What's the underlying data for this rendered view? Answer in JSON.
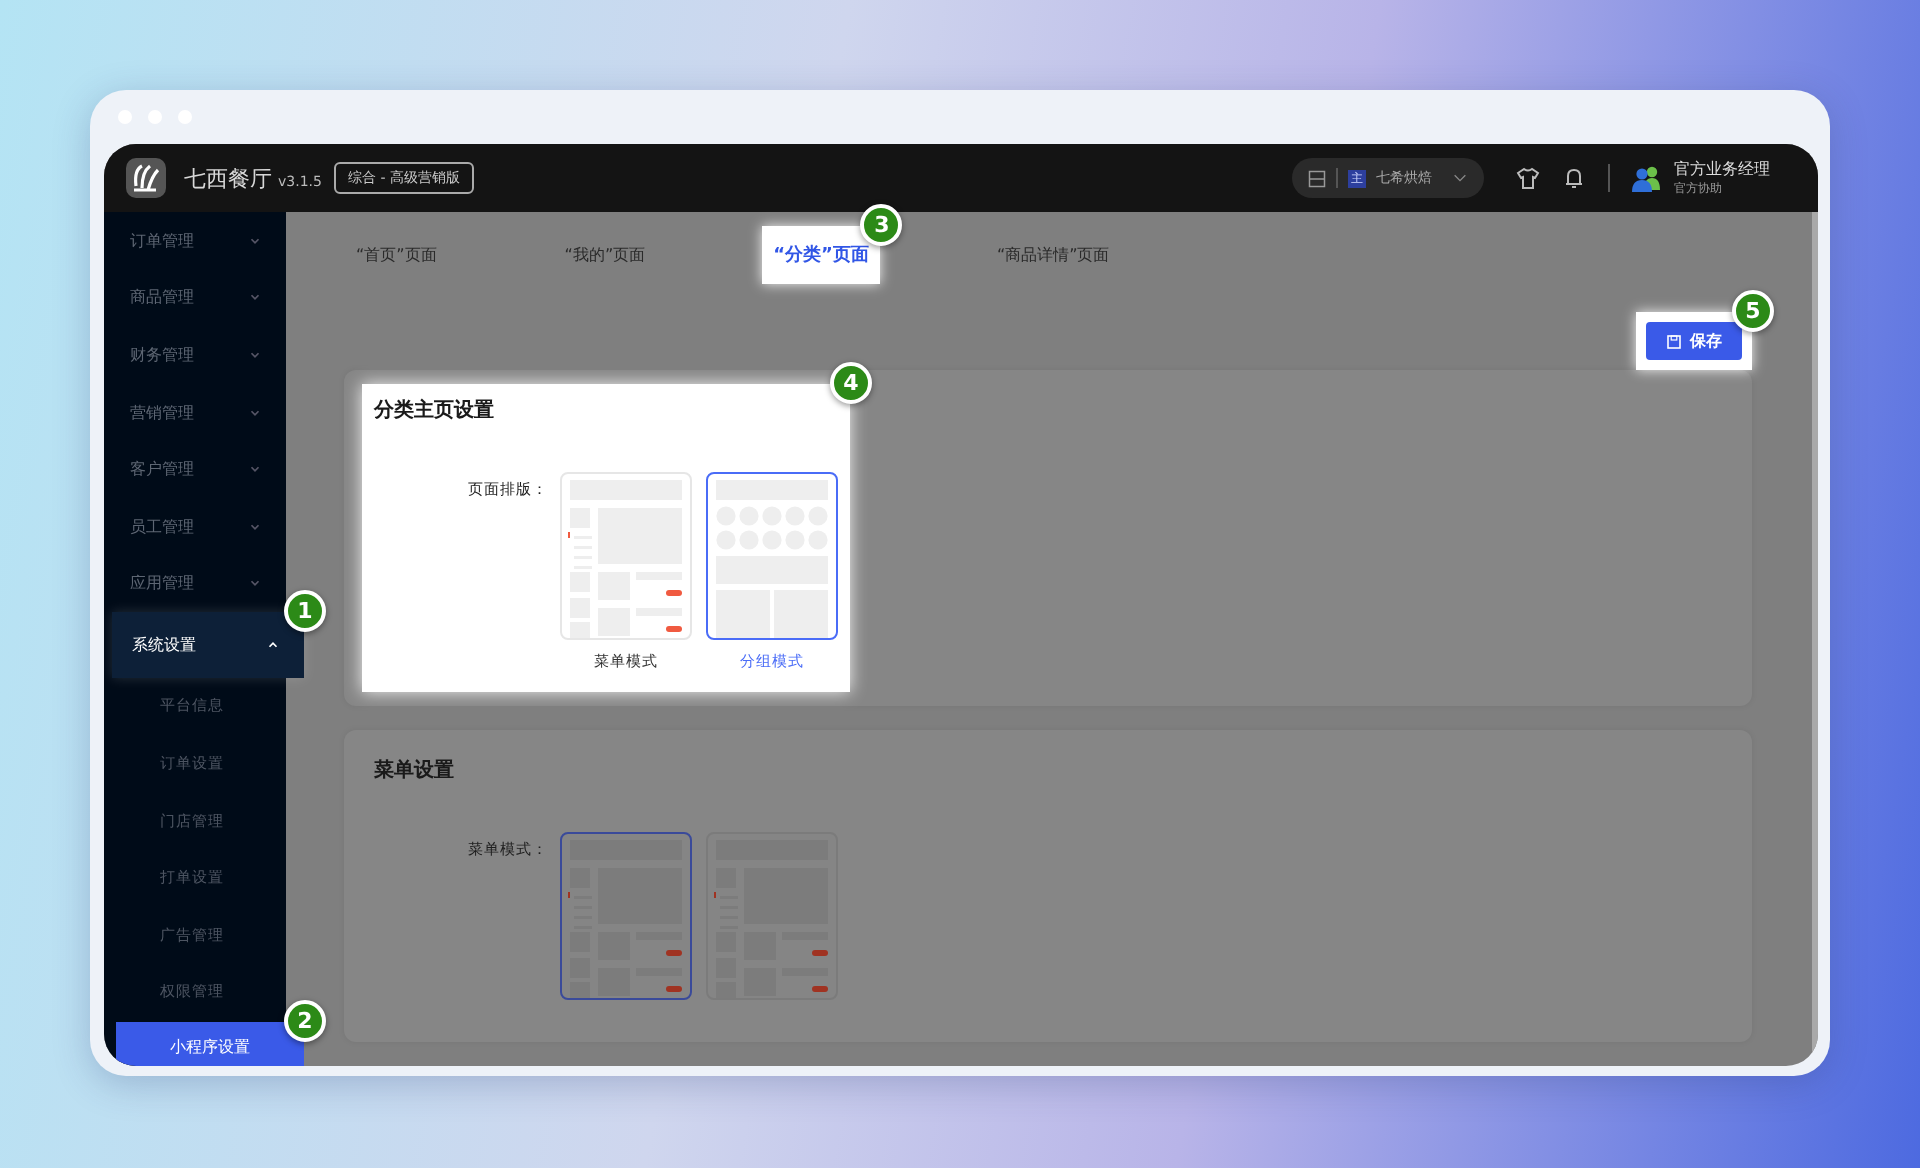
{
  "header": {
    "app_name": "七西餐厅",
    "version": "v3.1.5",
    "edition": "综合 - 高级营销版",
    "store_badge": "主",
    "store": "七希烘焙",
    "user_name": "官方业务经理",
    "user_role": "官方协助"
  },
  "sidebar": {
    "items": [
      {
        "label": "订单管理",
        "expanded": false
      },
      {
        "label": "商品管理",
        "expanded": false
      },
      {
        "label": "财务管理",
        "expanded": false
      },
      {
        "label": "营销管理",
        "expanded": false
      },
      {
        "label": "客户管理",
        "expanded": false
      },
      {
        "label": "员工管理",
        "expanded": false
      },
      {
        "label": "应用管理",
        "expanded": false
      },
      {
        "label": "系统设置",
        "expanded": true,
        "callout": "1",
        "children": [
          {
            "label": "平台信息",
            "selected": false
          },
          {
            "label": "订单设置",
            "selected": false
          },
          {
            "label": "门店管理",
            "selected": false
          },
          {
            "label": "打单设置",
            "selected": false
          },
          {
            "label": "广告管理",
            "selected": false
          },
          {
            "label": "权限管理",
            "selected": false
          },
          {
            "label": "小程序设置",
            "selected": true,
            "callout": "2"
          }
        ]
      }
    ]
  },
  "tabs": [
    {
      "label": "“首页”页面",
      "selected": false
    },
    {
      "label": "“我的”页面",
      "selected": false
    },
    {
      "label": "“分类”页面",
      "selected": true,
      "callout": "3"
    },
    {
      "label": "“商品详情”页面",
      "selected": false
    }
  ],
  "save_button": {
    "label": "保存",
    "callout": "5"
  },
  "sections": [
    {
      "title": "分类主页设置",
      "callout": "4",
      "field_label": "页面排版：",
      "options": [
        {
          "kind": "menu",
          "label": "菜单模式",
          "selected": false
        },
        {
          "kind": "group",
          "label": "分组模式",
          "selected": true
        }
      ]
    },
    {
      "title": "菜单设置",
      "field_label": "菜单模式：",
      "options": [
        {
          "kind": "menu",
          "selected": true
        },
        {
          "kind": "menu",
          "selected": false
        }
      ]
    }
  ]
}
